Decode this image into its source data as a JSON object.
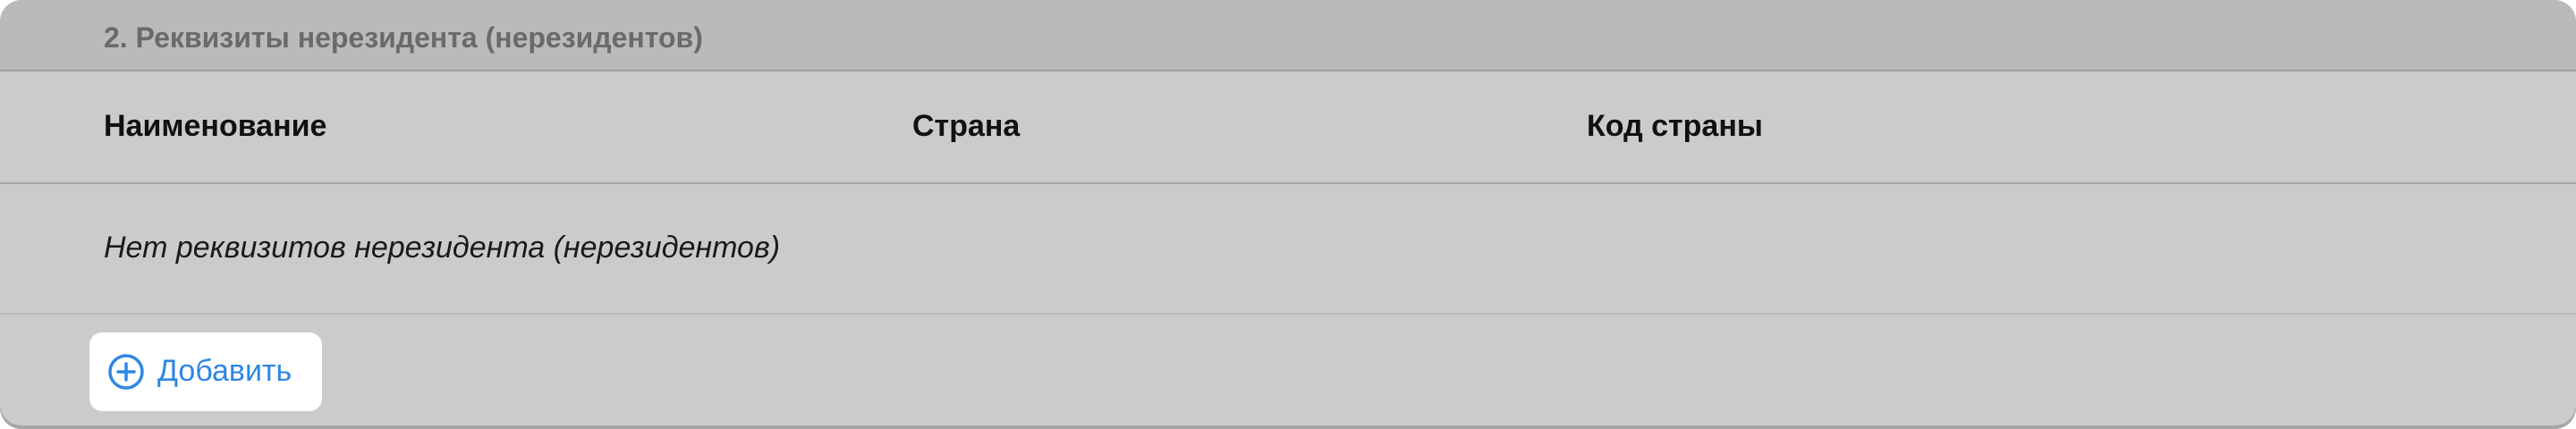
{
  "section": {
    "title": "2. Реквизиты нерезидента (нерезидентов)"
  },
  "table": {
    "columns": [
      "Наименование",
      "Страна",
      "Код страны"
    ],
    "empty_message": "Нет реквизитов нерезидента (нерезидентов)"
  },
  "actions": {
    "add_label": "Добавить",
    "add_icon": "plus-circle-icon"
  },
  "colors": {
    "panel_bg": "#cbcbcd",
    "header_bg": "#bababc",
    "accent": "#2f86e4"
  }
}
